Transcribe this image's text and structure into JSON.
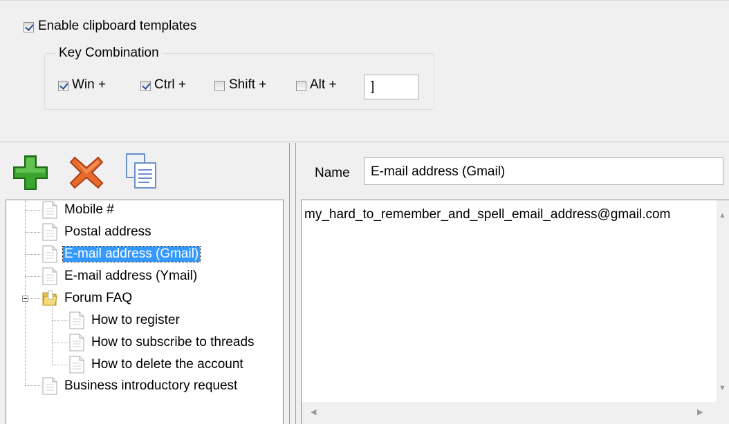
{
  "settings": {
    "enable_label": "Enable clipboard templates",
    "enable_checked": true,
    "group_title": "Key Combination",
    "modifiers": [
      {
        "label": "Win +",
        "checked": true
      },
      {
        "label": "Ctrl +",
        "checked": true
      },
      {
        "label": "Shift +",
        "checked": false
      },
      {
        "label": "Alt +",
        "checked": false
      }
    ],
    "key_value": "]"
  },
  "toolbar": {
    "add_icon": "add-icon",
    "delete_icon": "delete-icon",
    "copy_icon": "copy-icon"
  },
  "tree": {
    "items": [
      {
        "label": "Mobile #"
      },
      {
        "label": "Postal address"
      },
      {
        "label": "E-mail address (Gmail)",
        "selected": true
      },
      {
        "label": "E-mail address (Ymail)"
      },
      {
        "label": "Forum FAQ",
        "type": "folder",
        "expanded": true
      },
      {
        "label": "How to register"
      },
      {
        "label": "How to subscribe to threads"
      },
      {
        "label": "How to delete the account"
      },
      {
        "label": "Business introductory request"
      }
    ]
  },
  "editor": {
    "name_label": "Name",
    "name_value": "E-mail address (Gmail)",
    "content": "my_hard_to_remember_and_spell_email_address@gmail.com"
  },
  "colors": {
    "selection": "#3399ff",
    "add_icon": "#3aa62e",
    "delete_icon": "#e86a2b"
  }
}
